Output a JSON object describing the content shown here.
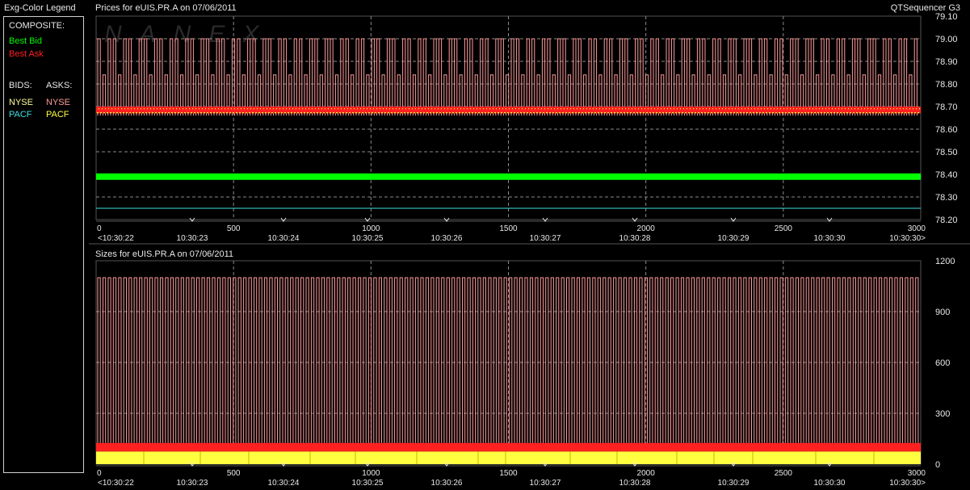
{
  "legend": {
    "title": "Exg-Color Legend",
    "composite_label": "COMPOSITE:",
    "best_bid": "Best Bid",
    "best_ask": "Best Ask",
    "bids_label": "BIDS:",
    "asks_label": "ASKS:",
    "bid_nyse": "NYSE",
    "bid_pacf": "PACF",
    "ask_nyse": "NYSE",
    "ask_pacf": "PACF",
    "colors": {
      "best_bid": "#00ff00",
      "best_ask": "#ff2020",
      "bid_nyse": "#ffff99",
      "bid_pacf": "#40e0e0",
      "ask_nyse": "#ff9a9a",
      "ask_pacf": "#ffff40"
    }
  },
  "app_title": "QTSequencer G3",
  "prices_header": "Prices for  eUIS.PR.A  on  07/06/2011",
  "sizes_header": "Sizes for  eUIS.PR.A  on  07/06/2011",
  "watermark": "NANEX",
  "chart_data": [
    {
      "type": "line",
      "title": "Prices for  eUIS.PR.A  on  07/06/2011",
      "xlim": [
        0,
        3000
      ],
      "x_ticks": [
        "0",
        "500",
        "1000",
        "1500",
        "2000",
        "2500",
        "3000"
      ],
      "time_ticks": [
        "<10:30:22",
        "10:30:23",
        "10:30:24",
        "10:30:25",
        "10:30:26",
        "10:30:27",
        "10:30:28",
        "10:30:29",
        "10:30:30",
        "10:30:30>"
      ],
      "ylim": [
        78.2,
        79.1
      ],
      "y_ticks": [
        "79.10",
        "79.00",
        "78.90",
        "78.80",
        "78.70",
        "78.60",
        "78.50",
        "78.40",
        "78.30",
        "78.20"
      ],
      "grid": true,
      "series": [
        {
          "name": "Best Bid",
          "color": "#00ff00",
          "values": [
            78.39
          ]
        },
        {
          "name": "Best Ask",
          "color": "#ff2020",
          "values": [
            78.67,
            78.7
          ]
        },
        {
          "name": "NYSE",
          "color": "#ff9a9a",
          "values": [
            78.66,
            79.0,
            78.84
          ]
        },
        {
          "name": "PACF",
          "color": "#ffff40",
          "values": [
            78.68
          ]
        },
        {
          "name": "PACF",
          "color": "#40e0e0",
          "values": [
            78.25
          ]
        }
      ]
    },
    {
      "type": "bar",
      "title": "Sizes for  eUIS.PR.A  on  07/06/2011",
      "xlim": [
        0,
        3000
      ],
      "x_ticks": [
        "0",
        "500",
        "1000",
        "1500",
        "2000",
        "2500",
        "3000"
      ],
      "time_ticks": [
        "<10:30:22",
        "10:30:23",
        "10:30:24",
        "10:30:25",
        "10:30:26",
        "10:30:27",
        "10:30:28",
        "10:30:29",
        "10:30:30",
        "10:30:30>"
      ],
      "ylim": [
        0,
        1200
      ],
      "y_ticks": [
        "1200",
        "900",
        "600",
        "300",
        "0"
      ],
      "grid": true,
      "series": [
        {
          "name": "NYSE",
          "color": "#ff9a9a",
          "values": [
            1100
          ]
        },
        {
          "name": "Best Ask",
          "color": "#ff2020",
          "values": [
            125
          ]
        },
        {
          "name": "PACF",
          "color": "#ffff40",
          "values": [
            75
          ]
        }
      ]
    }
  ]
}
